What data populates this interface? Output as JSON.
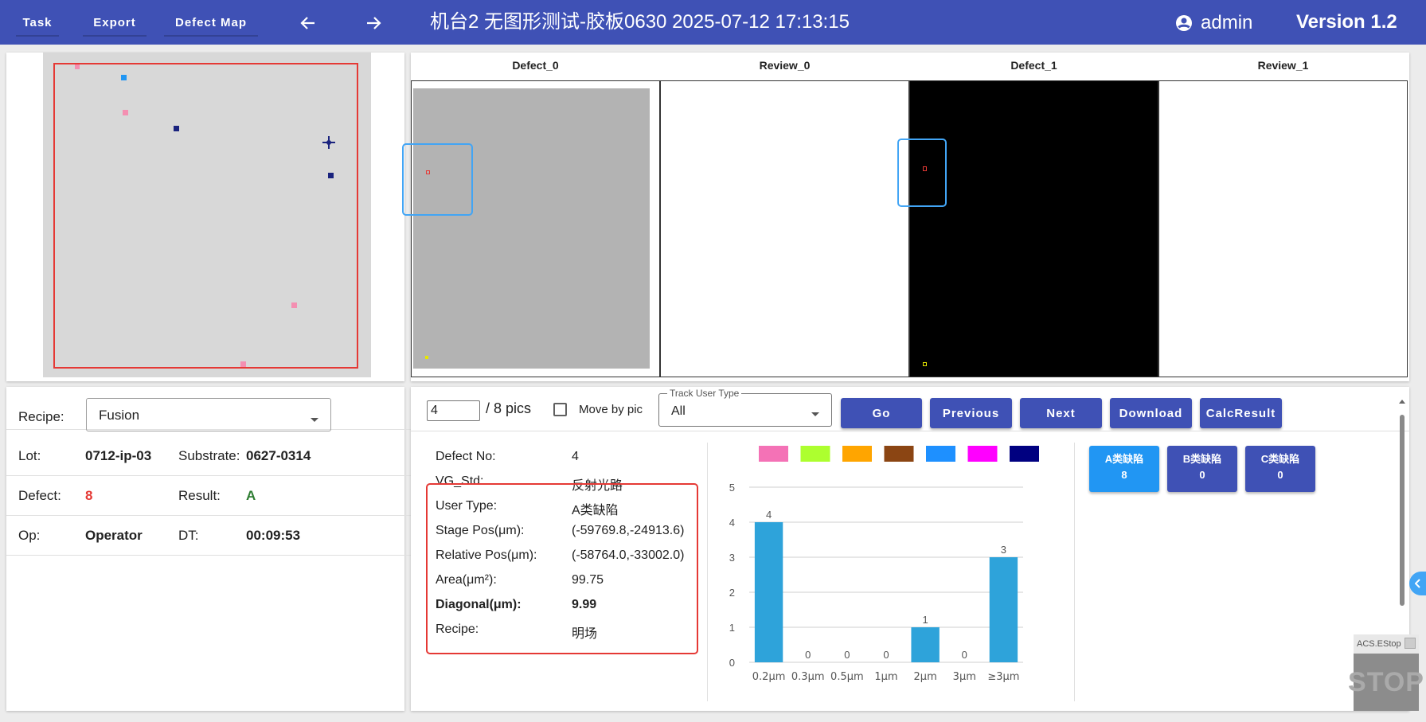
{
  "topbar": {
    "task_label": "Task",
    "export_label": "Export",
    "defect_map_label": "Defect Map",
    "title": "机台2   无图形测试-胶板0630   2025-07-12 17:13:15",
    "user": "admin",
    "version": "Version 1.2"
  },
  "images": {
    "panes": [
      "Defect_0",
      "Review_0",
      "Defect_1",
      "Review_1"
    ]
  },
  "info": {
    "recipe_label": "Recipe:",
    "recipe_value": "Fusion",
    "lot_label": "Lot:",
    "lot_value": "0712-ip-03",
    "substrate_label": "Substrate:",
    "substrate_value": "0627-0314",
    "defect_label": "Defect:",
    "defect_value": "8",
    "result_label": "Result:",
    "result_value": "A",
    "op_label": "Op:",
    "op_value": "Operator",
    "dt_label": "DT:",
    "dt_value": "00:09:53"
  },
  "controls": {
    "page_value": "4",
    "pics_label": "/ 8 pics",
    "move_by_pic_label": "Move by pic",
    "track_user_type_label": "Track User Type",
    "track_user_type_value": "All",
    "go": "Go",
    "previous": "Previous",
    "next": "Next",
    "download": "Download",
    "calc_result": "CalcResult"
  },
  "defect_details": [
    {
      "label": "Defect No:",
      "value": "4"
    },
    {
      "label": "VG_Std:",
      "value": "反射光路"
    },
    {
      "label": "User Type:",
      "value": "A类缺陷"
    },
    {
      "label": "Stage Pos(μm):",
      "value": "(-59769.8,-24913.6)"
    },
    {
      "label": "Relative Pos(μm):",
      "value": "(-58764.0,-33002.0)"
    },
    {
      "label": "Area(μm²):",
      "value": "99.75"
    },
    {
      "label": "Diagonal(μm):",
      "value": "9.99"
    },
    {
      "label": "Recipe:",
      "value": "明场"
    }
  ],
  "legend_colors": [
    "#f472b6",
    "#adff2f",
    "#ffa500",
    "#8b4513",
    "#1e90ff",
    "#ff00ff",
    "#000080"
  ],
  "chart_data": {
    "type": "bar",
    "categories": [
      "0.2μm",
      "0.3μm",
      "0.5μm",
      "1μm",
      "2μm",
      "3μm",
      "≥3μm"
    ],
    "values": [
      4,
      0,
      0,
      0,
      1,
      0,
      3
    ],
    "ylim": [
      0,
      5
    ],
    "yticks": [
      "0",
      "1",
      "2",
      "3",
      "4",
      "5"
    ],
    "bar_color": "#2ea3da",
    "grid": true
  },
  "class_counts": [
    {
      "label": "A类缺陷",
      "count": "8",
      "color": "#2196f3"
    },
    {
      "label": "B类缺陷",
      "count": "0",
      "color": "#3f51b5"
    },
    {
      "label": "C类缺陷",
      "count": "0",
      "color": "#3f51b5"
    }
  ],
  "estop": {
    "label": "ACS.EStop",
    "stop_text": "STOP"
  }
}
